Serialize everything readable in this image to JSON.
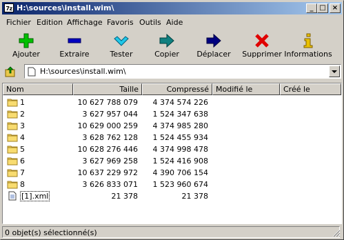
{
  "window": {
    "app_icon_text": "7z",
    "title": "H:\\sources\\install.wim\\",
    "controls": {
      "minimize": "_",
      "maximize": "□",
      "close": "×"
    }
  },
  "menu": [
    "Fichier",
    "Edition",
    "Affichage",
    "Favoris",
    "Outils",
    "Aide"
  ],
  "toolbar": [
    {
      "label": "Ajouter",
      "icon": "plus-icon",
      "color": "#00c000"
    },
    {
      "label": "Extraire",
      "icon": "minus-icon",
      "color": "#0000c0"
    },
    {
      "label": "Tester",
      "icon": "check-icon",
      "color": "#00c0e0"
    },
    {
      "label": "Copier",
      "icon": "copy-arrow-icon",
      "color": "#008080"
    },
    {
      "label": "Déplacer",
      "icon": "move-arrow-icon",
      "color": "#000080"
    },
    {
      "label": "Supprimer",
      "icon": "delete-x-icon",
      "color": "#e00000"
    },
    {
      "label": "Informations",
      "icon": "info-icon",
      "color": "#e0c000"
    }
  ],
  "address": {
    "value": "H:\\sources\\install.wim\\"
  },
  "columns": [
    "Nom",
    "Taille",
    "Compressé",
    "Modifié le",
    "Créé le"
  ],
  "rows": [
    {
      "name": "1",
      "type": "folder",
      "size": "10 627 788 079",
      "packed": "4 374 574 226"
    },
    {
      "name": "2",
      "type": "folder",
      "size": "3 627 957 044",
      "packed": "1 524 347 638"
    },
    {
      "name": "3",
      "type": "folder",
      "size": "10 629 000 259",
      "packed": "4 374 985 280"
    },
    {
      "name": "4",
      "type": "folder",
      "size": "3 628 762 128",
      "packed": "1 524 455 934"
    },
    {
      "name": "5",
      "type": "folder",
      "size": "10 628 276 446",
      "packed": "4 374 998 478"
    },
    {
      "name": "6",
      "type": "folder",
      "size": "3 627 969 258",
      "packed": "1 524 416 908"
    },
    {
      "name": "7",
      "type": "folder",
      "size": "10 637 229 972",
      "packed": "4 390 706 154"
    },
    {
      "name": "8",
      "type": "folder",
      "size": "3 626 833 071",
      "packed": "1 523 960 674"
    },
    {
      "name": "[1].xml",
      "type": "file",
      "size": "21 378",
      "packed": "21 378",
      "focused": true
    }
  ],
  "status": {
    "text": "0 objet(s) sélectionné(s)"
  }
}
